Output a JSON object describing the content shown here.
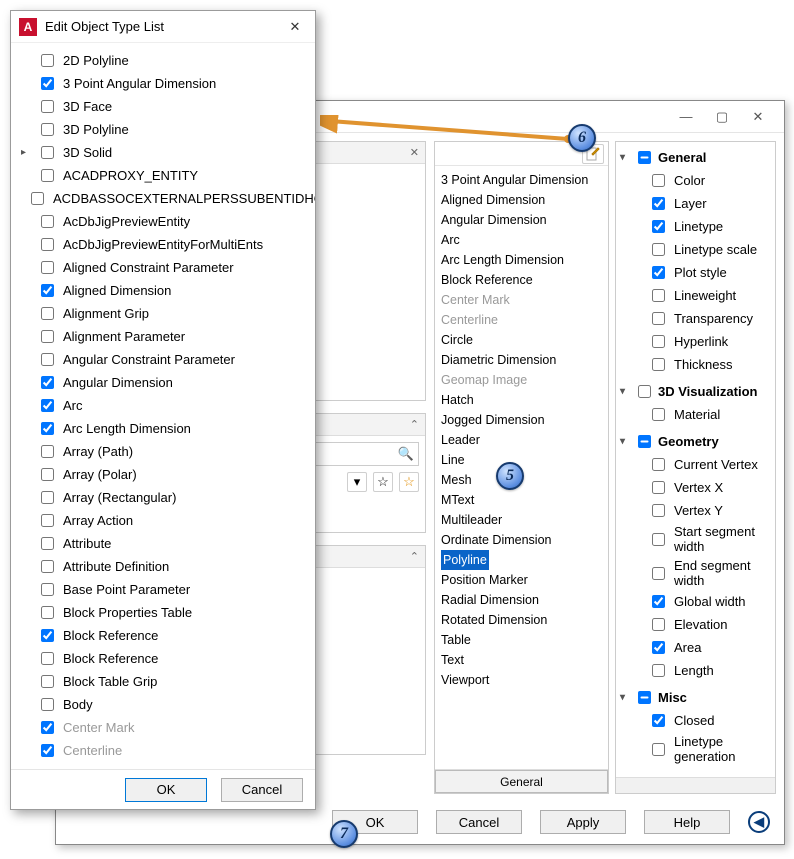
{
  "fg": {
    "title": "Edit Object Type List",
    "ok": "OK",
    "cancel": "Cancel",
    "items": [
      {
        "label": "2D Polyline",
        "checked": false
      },
      {
        "label": "3 Point Angular Dimension",
        "checked": true
      },
      {
        "label": "3D Face",
        "checked": false
      },
      {
        "label": "3D Polyline",
        "checked": false
      },
      {
        "label": "3D Solid",
        "checked": false,
        "expandable": true
      },
      {
        "label": "ACADPROXY_ENTITY",
        "checked": false
      },
      {
        "label": "ACDBASSOCEXTERNALPERSSUBENTIDHO",
        "checked": false,
        "cut": true
      },
      {
        "label": "AcDbJigPreviewEntity",
        "checked": false
      },
      {
        "label": "AcDbJigPreviewEntityForMultiEnts",
        "checked": false
      },
      {
        "label": "Aligned Constraint Parameter",
        "checked": false
      },
      {
        "label": "Aligned Dimension",
        "checked": true
      },
      {
        "label": "Alignment Grip",
        "checked": false
      },
      {
        "label": "Alignment Parameter",
        "checked": false
      },
      {
        "label": "Angular Constraint Parameter",
        "checked": false
      },
      {
        "label": "Angular Dimension",
        "checked": true
      },
      {
        "label": "Arc",
        "checked": true
      },
      {
        "label": "Arc Length Dimension",
        "checked": true
      },
      {
        "label": "Array (Path)",
        "checked": false
      },
      {
        "label": "Array (Polar)",
        "checked": false
      },
      {
        "label": "Array (Rectangular)",
        "checked": false
      },
      {
        "label": "Array Action",
        "checked": false
      },
      {
        "label": "Attribute",
        "checked": false
      },
      {
        "label": "Attribute Definition",
        "checked": false
      },
      {
        "label": "Base Point Parameter",
        "checked": false
      },
      {
        "label": "Block Properties Table",
        "checked": false
      },
      {
        "label": "Block Reference",
        "checked": true
      },
      {
        "label": "Block Reference",
        "checked": false
      },
      {
        "label": "Block Table Grip",
        "checked": false
      },
      {
        "label": "Body",
        "checked": false
      },
      {
        "label": "Center Mark",
        "checked": true,
        "disabled": true
      },
      {
        "label": "Centerline",
        "checked": true,
        "disabled": true
      }
    ]
  },
  "mid": {
    "footer": "General",
    "items": [
      {
        "label": "3 Point Angular Dimension"
      },
      {
        "label": "Aligned Dimension"
      },
      {
        "label": "Angular Dimension"
      },
      {
        "label": "Arc"
      },
      {
        "label": "Arc Length Dimension"
      },
      {
        "label": "Block Reference"
      },
      {
        "label": "Center Mark",
        "disabled": true
      },
      {
        "label": "Centerline",
        "disabled": true
      },
      {
        "label": "Circle"
      },
      {
        "label": "Diametric Dimension"
      },
      {
        "label": "Geomap Image",
        "disabled": true
      },
      {
        "label": "Hatch"
      },
      {
        "label": "Jogged Dimension"
      },
      {
        "label": "Leader"
      },
      {
        "label": "Line"
      },
      {
        "label": "Mesh"
      },
      {
        "label": "MText"
      },
      {
        "label": "Multileader"
      },
      {
        "label": "Ordinate Dimension"
      },
      {
        "label": "Polyline",
        "selected": true
      },
      {
        "label": "Position Marker"
      },
      {
        "label": "Radial Dimension"
      },
      {
        "label": "Rotated Dimension"
      },
      {
        "label": "Table"
      },
      {
        "label": "Text"
      },
      {
        "label": "Viewport"
      }
    ]
  },
  "props": {
    "groups": [
      {
        "name": "General",
        "state": "mixed",
        "expanded": true,
        "items": [
          {
            "label": "Color",
            "checked": false
          },
          {
            "label": "Layer",
            "checked": true
          },
          {
            "label": "Linetype",
            "checked": true
          },
          {
            "label": "Linetype scale",
            "checked": false
          },
          {
            "label": "Plot style",
            "checked": true
          },
          {
            "label": "Lineweight",
            "checked": false
          },
          {
            "label": "Transparency",
            "checked": false
          },
          {
            "label": "Hyperlink",
            "checked": false
          },
          {
            "label": "Thickness",
            "checked": false
          }
        ]
      },
      {
        "name": "3D Visualization",
        "state": "unchecked",
        "expanded": true,
        "items": [
          {
            "label": "Material",
            "checked": false
          }
        ]
      },
      {
        "name": "Geometry",
        "state": "mixed",
        "expanded": true,
        "items": [
          {
            "label": "Current Vertex",
            "checked": false
          },
          {
            "label": "Vertex X",
            "checked": false
          },
          {
            "label": "Vertex Y",
            "checked": false
          },
          {
            "label": "Start segment width",
            "checked": false
          },
          {
            "label": "End segment width",
            "checked": false
          },
          {
            "label": "Global width",
            "checked": true
          },
          {
            "label": "Elevation",
            "checked": false
          },
          {
            "label": "Area",
            "checked": true
          },
          {
            "label": "Length",
            "checked": false
          }
        ]
      },
      {
        "name": "Misc",
        "state": "mixed",
        "expanded": true,
        "items": [
          {
            "label": "Closed",
            "checked": true
          },
          {
            "label": "Linetype generation",
            "checked": false
          }
        ]
      }
    ]
  },
  "main_buttons": {
    "ok": "OK",
    "cancel": "Cancel",
    "apply": "Apply",
    "help": "Help"
  },
  "badges": {
    "b5": "5",
    "b6": "6",
    "b7": "7"
  }
}
